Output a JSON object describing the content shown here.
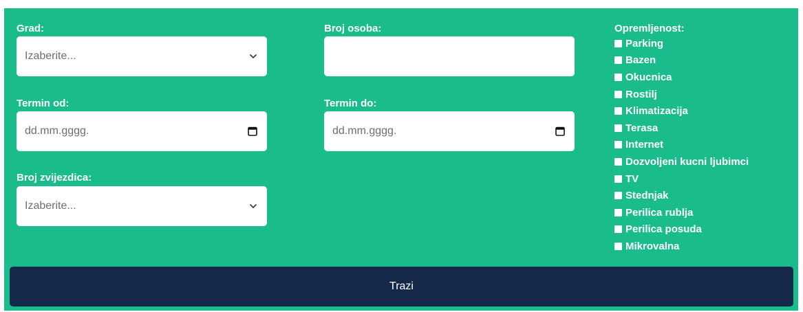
{
  "form": {
    "city": {
      "label": "Grad:",
      "placeholder": "Izaberite..."
    },
    "persons": {
      "label": "Broj osoba:",
      "value": ""
    },
    "date_from": {
      "label": "Termin od:",
      "placeholder": "dd.mm.gggg."
    },
    "date_to": {
      "label": "Termin do:",
      "placeholder": "dd.mm.gggg."
    },
    "stars": {
      "label": "Broj zvijezdica:",
      "placeholder": "Izaberite..."
    }
  },
  "amenities": {
    "title": "Opremljenost:",
    "items": [
      {
        "label": "Parking",
        "checked": false
      },
      {
        "label": "Bazen",
        "checked": false
      },
      {
        "label": "Okucnica",
        "checked": false
      },
      {
        "label": "Rostilj",
        "checked": false
      },
      {
        "label": "Klimatizacija",
        "checked": false
      },
      {
        "label": "Terasa",
        "checked": false
      },
      {
        "label": "Internet",
        "checked": false
      },
      {
        "label": "Dozvoljeni kucni ljubimci",
        "checked": false
      },
      {
        "label": "TV",
        "checked": false
      },
      {
        "label": "Stednjak",
        "checked": false
      },
      {
        "label": "Perilica rublja",
        "checked": false
      },
      {
        "label": "Perilica posuda",
        "checked": false
      },
      {
        "label": "Mikrovalna",
        "checked": false
      }
    ]
  },
  "search_button": {
    "label": "Trazi"
  },
  "colors": {
    "panel_bg": "#1abc8c",
    "button_bg": "#14294a",
    "text_on_panel": "#ffffff"
  },
  "icons": {
    "select_chevron": "chevron-down-icon",
    "date_picker": "calendar-icon"
  }
}
